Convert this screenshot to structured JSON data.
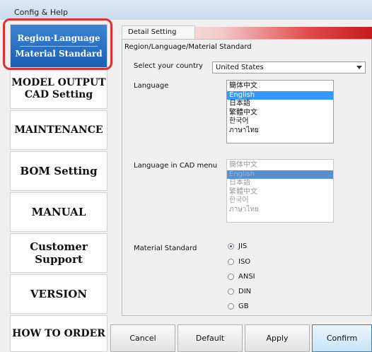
{
  "window": {
    "title": "Config & Help"
  },
  "sidebar": {
    "active": {
      "line1": "Region·Language",
      "line2": "Material Standard"
    },
    "items": [
      {
        "line1": "MODEL OUTPUT",
        "line2": "CAD Setting"
      },
      {
        "label": "MAINTENANCE"
      },
      {
        "label": "BOM Setting"
      },
      {
        "label": "MANUAL"
      },
      {
        "line1": "Customer",
        "line2": "Support"
      },
      {
        "label": "VERSION"
      },
      {
        "label": "HOW TO ORDER"
      }
    ]
  },
  "panel": {
    "tab_label": "Detail Setting",
    "title": "Region/Language/Material Standard",
    "country_label": "Select your country",
    "country_value": "United States",
    "language_label": "Language",
    "languages": [
      "簡体中文",
      "English",
      "日本語",
      "繁體中文",
      "한국어",
      "ภาษาไทย"
    ],
    "language_selected_index": 1,
    "cad_language_label": "Language in CAD menu",
    "cad_languages": [
      "簡体中文",
      "English",
      "日本語",
      "繁體中文",
      "한국어",
      "ภาษาไทย"
    ],
    "material_label": "Material Standard",
    "materials": [
      "JIS",
      "ISO",
      "ANSI",
      "DIN",
      "GB"
    ],
    "material_selected": "JIS"
  },
  "buttons": {
    "cancel": "Cancel",
    "default": "Default",
    "apply": "Apply",
    "confirm": "Confirm"
  },
  "colors": {
    "active_tab": "#1b5fb4",
    "highlight_ring": "#e03030",
    "accent_strip": "#c41c1c",
    "selection": "#3399ff"
  }
}
